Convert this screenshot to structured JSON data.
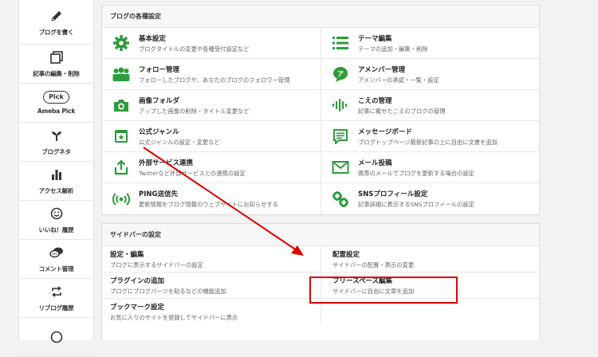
{
  "sidebar": {
    "items": [
      {
        "label": "ブログを書く",
        "icon": "pencil-icon"
      },
      {
        "label": "記事の編集・削除",
        "icon": "documents-icon"
      },
      {
        "label": "Ameba Pick",
        "icon": "pick-badge-icon",
        "badge": "Pick"
      },
      {
        "label": "ブログネタ",
        "icon": "sprout-icon"
      },
      {
        "label": "アクセス解析",
        "icon": "bar-chart-icon"
      },
      {
        "label": "いいね！履歴",
        "icon": "smiley-icon"
      },
      {
        "label": "コメント管理",
        "icon": "speech-bubbles-icon"
      },
      {
        "label": "リブログ履歴",
        "icon": "reblog-icon"
      }
    ]
  },
  "blog_settings": {
    "title": "ブログの各種設定",
    "items": [
      {
        "title": "基本設定",
        "desc": "ブログタイトルの変更や各種受付設定など",
        "icon": "gear-icon"
      },
      {
        "title": "テーマ編集",
        "desc": "テーマの追加・編集・削除",
        "icon": "list-icon"
      },
      {
        "title": "フォロー管理",
        "desc": "フォローしたブログや、あなたのブログのフォロワー管理",
        "icon": "people-icon"
      },
      {
        "title": "アメンバー管理",
        "desc": "アメンバーの承認・一覧・設定",
        "icon": "amember-bubble-icon"
      },
      {
        "title": "画像フォルダ",
        "desc": "アップした画像の削除・タイトル変更など",
        "icon": "camera-icon"
      },
      {
        "title": "こえの管理",
        "desc": "記事に載せたこえのブログの管理",
        "icon": "voice-wave-icon"
      },
      {
        "title": "公式ジャンル",
        "desc": "公式ジャンルの設定・変更など",
        "icon": "calendar-star-icon"
      },
      {
        "title": "メッセージボード",
        "desc": "ブログトップページ最新記事の上に自由に文書を追加",
        "icon": "message-board-icon"
      },
      {
        "title": "外部サービス連携",
        "desc": "Twitterなど外部サービスとの連携の設定",
        "icon": "share-upload-icon"
      },
      {
        "title": "メール投稿",
        "desc": "携帯のメールでブログを更新する場合の設定",
        "icon": "mail-icon"
      },
      {
        "title": "PING送信先",
        "desc": "更新情報をブログ情報のウェブサイトにお知らせする",
        "icon": "broadcast-icon"
      },
      {
        "title": "SNSプロフィール設定",
        "desc": "記事詳細に表示するSNSプロフィールの設定",
        "icon": "link-icon"
      }
    ]
  },
  "sidebar_settings": {
    "title": "サイドバーの設定",
    "items": [
      {
        "title": "設定・編集",
        "desc": "ブログに表示するサイドバーの設定"
      },
      {
        "title": "配置設定",
        "desc": "サイドバーの配置・表示の変更"
      },
      {
        "title": "プラグインの追加",
        "desc": "ブログにブログパーツを貼るなどの機能追加"
      },
      {
        "title": "フリースペース編集",
        "desc": "サイドバーに自由に文章を追加"
      },
      {
        "title": "ブックマーク設定",
        "desc": "お気に入りのサイトを登録してサイドバーに表示"
      }
    ]
  },
  "colors": {
    "accent_green": "#2d9c3c",
    "annotation_red": "#e00000"
  }
}
